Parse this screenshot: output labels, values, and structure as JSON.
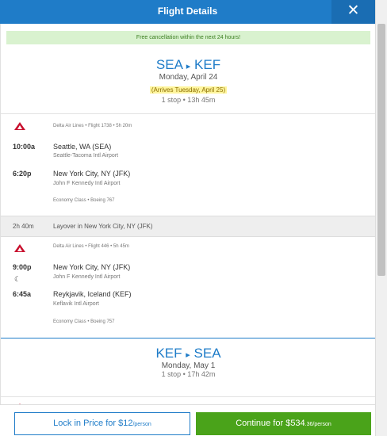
{
  "header": {
    "title": "Flight Details",
    "close_label": "✕"
  },
  "notice": "Free cancellation within the next 24 hours!",
  "outbound": {
    "code_from": "SEA",
    "code_to": "KEF",
    "date": "Monday, April 24",
    "arrives": "(Arrives Tuesday, April 25)",
    "stops": "1 stop • 13h 45m",
    "segments": [
      {
        "carrier": "Delta Air Lines • Flight 1738 • 5h 20m",
        "depart_time": "10:00a",
        "depart_city": "Seattle, WA (SEA)",
        "depart_airport": "Seattle-Tacoma Intl Airport",
        "arrive_time": "6:20p",
        "arrive_city": "New York City, NY (JFK)",
        "arrive_airport": "John F Kennedy Intl Airport",
        "aircraft": "Economy Class • Boeing 767"
      },
      {
        "carrier": "Delta Air Lines • Flight 446 • 5h 45m",
        "depart_time": "9:00p",
        "depart_city": "New York City, NY (JFK)",
        "depart_airport": "John F Kennedy Intl Airport",
        "arrive_time": "6:45a",
        "arrive_city": "Reykjavik, Iceland (KEF)",
        "arrive_airport": "Keflavik Intl Airport",
        "aircraft": "Economy Class • Boeing 757"
      }
    ],
    "layover": {
      "duration": "2h 40m",
      "text": "Layover in New York City, NY (JFK)"
    }
  },
  "return": {
    "code_from": "KEF",
    "code_to": "SEA",
    "date": "Monday, May 1",
    "stops": "1 stop • 17h 42m"
  },
  "footer": {
    "lock_main": "Lock in Price for $12",
    "lock_sub": "/person",
    "continue_main": "Continue for $534",
    "continue_sub": ".36/person"
  },
  "icons": {
    "airline": "delta-logo-icon",
    "overnight": "moon-icon",
    "close": "close-icon"
  },
  "colors": {
    "accent": "#1f7cc8",
    "continue": "#4aa31a",
    "delta_red": "#c8102e",
    "notice_bg": "#d9f2cf"
  }
}
